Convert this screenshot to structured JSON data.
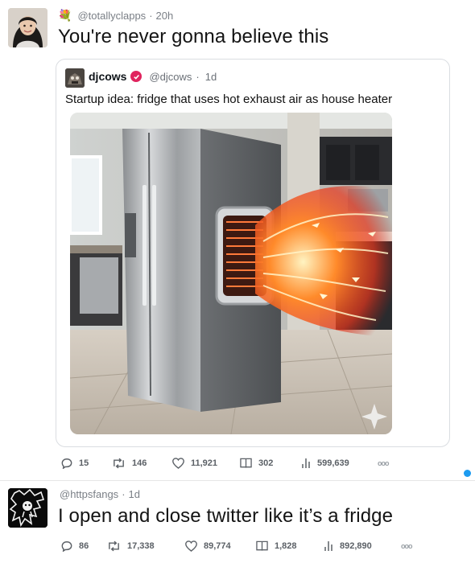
{
  "post1": {
    "emoji": "💐",
    "handle": "@totallyclapps",
    "time": "20h",
    "text": "You're never gonna believe this",
    "quote": {
      "name": "djcows",
      "handle": "@djcows",
      "time": "1d",
      "text": "Startup idea: fridge that uses hot exhaust air as house heater"
    },
    "stats": {
      "replies": "15",
      "reposts": "146",
      "likes": "11,921",
      "bookmarks": "302",
      "views": "599,639"
    }
  },
  "post2": {
    "handle": "@httpsfangs",
    "time": "1d",
    "text": "I open and close twitter like it’s a fridge",
    "stats": {
      "replies": "86",
      "reposts": "17,338",
      "likes": "89,774",
      "bookmarks": "1,828",
      "views": "892,890"
    }
  },
  "colors": {
    "accent": "#1d9bf0",
    "verified": "#e0245e"
  }
}
